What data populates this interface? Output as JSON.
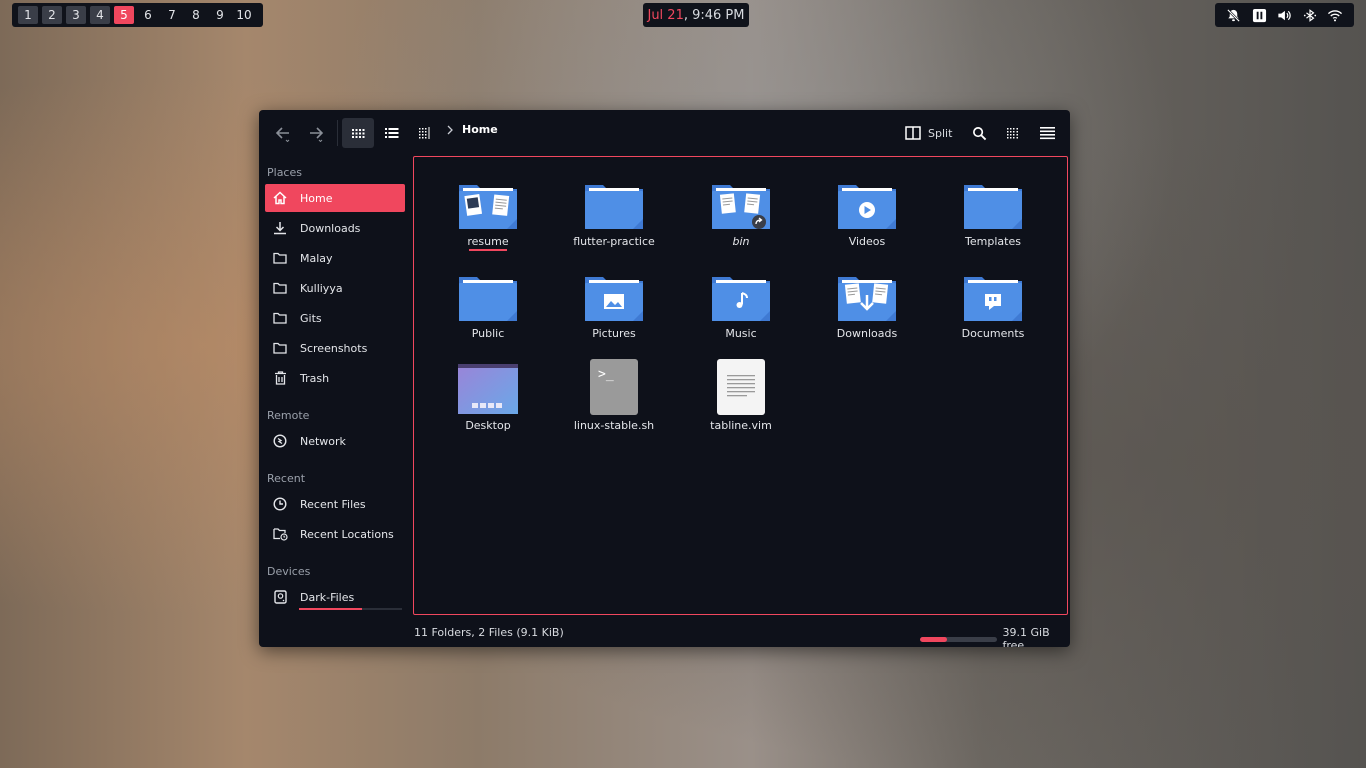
{
  "topbar": {
    "workspaces": [
      "1",
      "2",
      "3",
      "4",
      "5",
      "6",
      "7",
      "8",
      "9",
      "10"
    ],
    "active_workspace": "5",
    "clock": {
      "date": "Jul 21",
      "separator": ", ",
      "time": "9:46 PM"
    },
    "tray_icons": [
      "notifications-off-icon",
      "pause-icon",
      "volume-icon",
      "bluetooth-icon",
      "wifi-icon"
    ]
  },
  "window": {
    "breadcrumb": "Home",
    "split_label": "Split"
  },
  "sidebar": {
    "places_title": "Places",
    "places": [
      {
        "label": "Home",
        "icon": "home-icon"
      },
      {
        "label": "Downloads",
        "icon": "download-icon"
      },
      {
        "label": "Malay",
        "icon": "folder-icon"
      },
      {
        "label": "Kulliyya",
        "icon": "folder-icon"
      },
      {
        "label": "Gits",
        "icon": "folder-icon"
      },
      {
        "label": "Screenshots",
        "icon": "folder-icon"
      },
      {
        "label": "Trash",
        "icon": "trash-icon"
      }
    ],
    "remote_title": "Remote",
    "remote": [
      {
        "label": "Network",
        "icon": "network-icon"
      }
    ],
    "recent_title": "Recent",
    "recent": [
      {
        "label": "Recent Files",
        "icon": "clock-icon"
      },
      {
        "label": "Recent Locations",
        "icon": "folder-clock-icon"
      }
    ],
    "devices_title": "Devices",
    "devices": [
      {
        "label": "Dark-Files",
        "icon": "drive-icon"
      }
    ]
  },
  "files": [
    {
      "name": "resume",
      "type": "folder",
      "emblem": "documents"
    },
    {
      "name": "flutter-practice",
      "type": "folder"
    },
    {
      "name": "bin",
      "type": "folder-link"
    },
    {
      "name": "Videos",
      "type": "folder",
      "emblem": "play"
    },
    {
      "name": "Templates",
      "type": "folder"
    },
    {
      "name": "Public",
      "type": "folder"
    },
    {
      "name": "Pictures",
      "type": "folder",
      "emblem": "image"
    },
    {
      "name": "Music",
      "type": "folder",
      "emblem": "music"
    },
    {
      "name": "Downloads",
      "type": "folder",
      "emblem": "download"
    },
    {
      "name": "Documents",
      "type": "folder",
      "emblem": "quote"
    },
    {
      "name": "Desktop",
      "type": "desktop-thumbnail"
    },
    {
      "name": "linux-stable.sh",
      "type": "script",
      "glyph": ">_"
    },
    {
      "name": "tabline.vim",
      "type": "text"
    }
  ],
  "statusbar": {
    "summary": "11 Folders, 2 Files (9.1 KiB)",
    "free_space": "39.1 GiB free",
    "disk_used_fraction": 0.35
  },
  "colors": {
    "accent": "#f0475e",
    "folder": "#4f8fe6",
    "window_bg": "#0e111a"
  }
}
